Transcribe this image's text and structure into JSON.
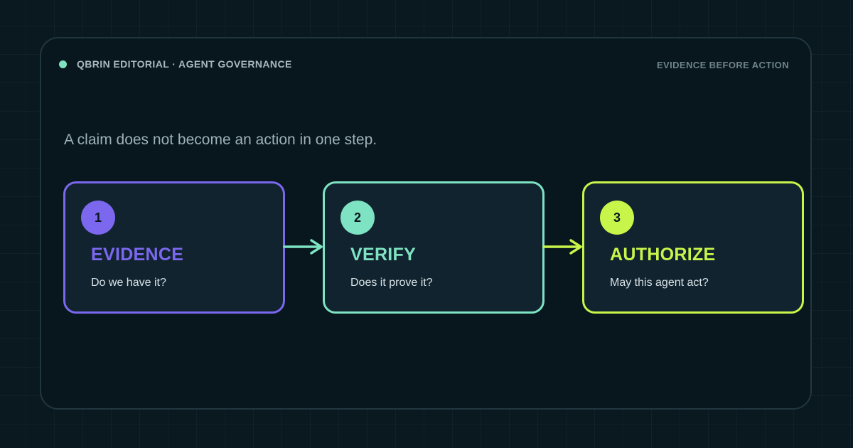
{
  "header": {
    "brand": "QBRIN EDITORIAL · AGENT GOVERNANCE",
    "tagline": "EVIDENCE BEFORE ACTION",
    "status_dot_color": "#7ee3c2"
  },
  "headline": "A claim does not become an action in one step.",
  "steps": [
    {
      "number": "1",
      "title": "EVIDENCE",
      "subtitle": "Do we have it?",
      "color": "#7b68ee"
    },
    {
      "number": "2",
      "title": "VERIFY",
      "subtitle": "Does it prove it?",
      "color": "#7ee3c2"
    },
    {
      "number": "3",
      "title": "AUTHORIZE",
      "subtitle": "May this agent act?",
      "color": "#c8f54a"
    }
  ],
  "connectors": [
    {
      "from": "1",
      "to": "2",
      "color": "#7ee3c2",
      "icon": "arrow-right-icon"
    },
    {
      "from": "2",
      "to": "3",
      "color": "#c8f54a",
      "icon": "arrow-right-icon"
    }
  ]
}
